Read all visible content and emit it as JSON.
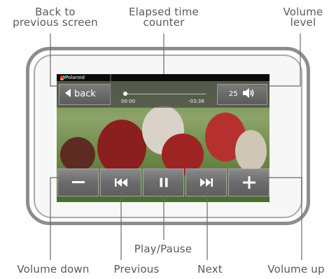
{
  "callouts": {
    "back": [
      "Back to",
      "previous screen"
    ],
    "elapsed": [
      "Elapsed time",
      "counter"
    ],
    "volume_level": [
      "Volume",
      "level"
    ],
    "play_pause": "Play/Pause",
    "volume_down": "Volume down",
    "previous": "Previous",
    "next": "Next",
    "volume_up": "Volume up"
  },
  "screen": {
    "brand": "Polaroid",
    "back_label": "back",
    "elapsed_time": "00:00",
    "remaining_time": "-03:38",
    "volume_value": "25",
    "progress": 0.0
  },
  "icons": {
    "volume_down": "minus-icon",
    "previous": "skip-back-icon",
    "play_pause": "pause-icon",
    "next": "skip-forward-icon",
    "volume_up": "plus-icon",
    "speaker": "speaker-icon",
    "back": "left-triangle-icon"
  },
  "colors": {
    "callout_text": "#5a5a5a",
    "bezel": "#8d8d8d",
    "button": "#6c6c6c"
  }
}
